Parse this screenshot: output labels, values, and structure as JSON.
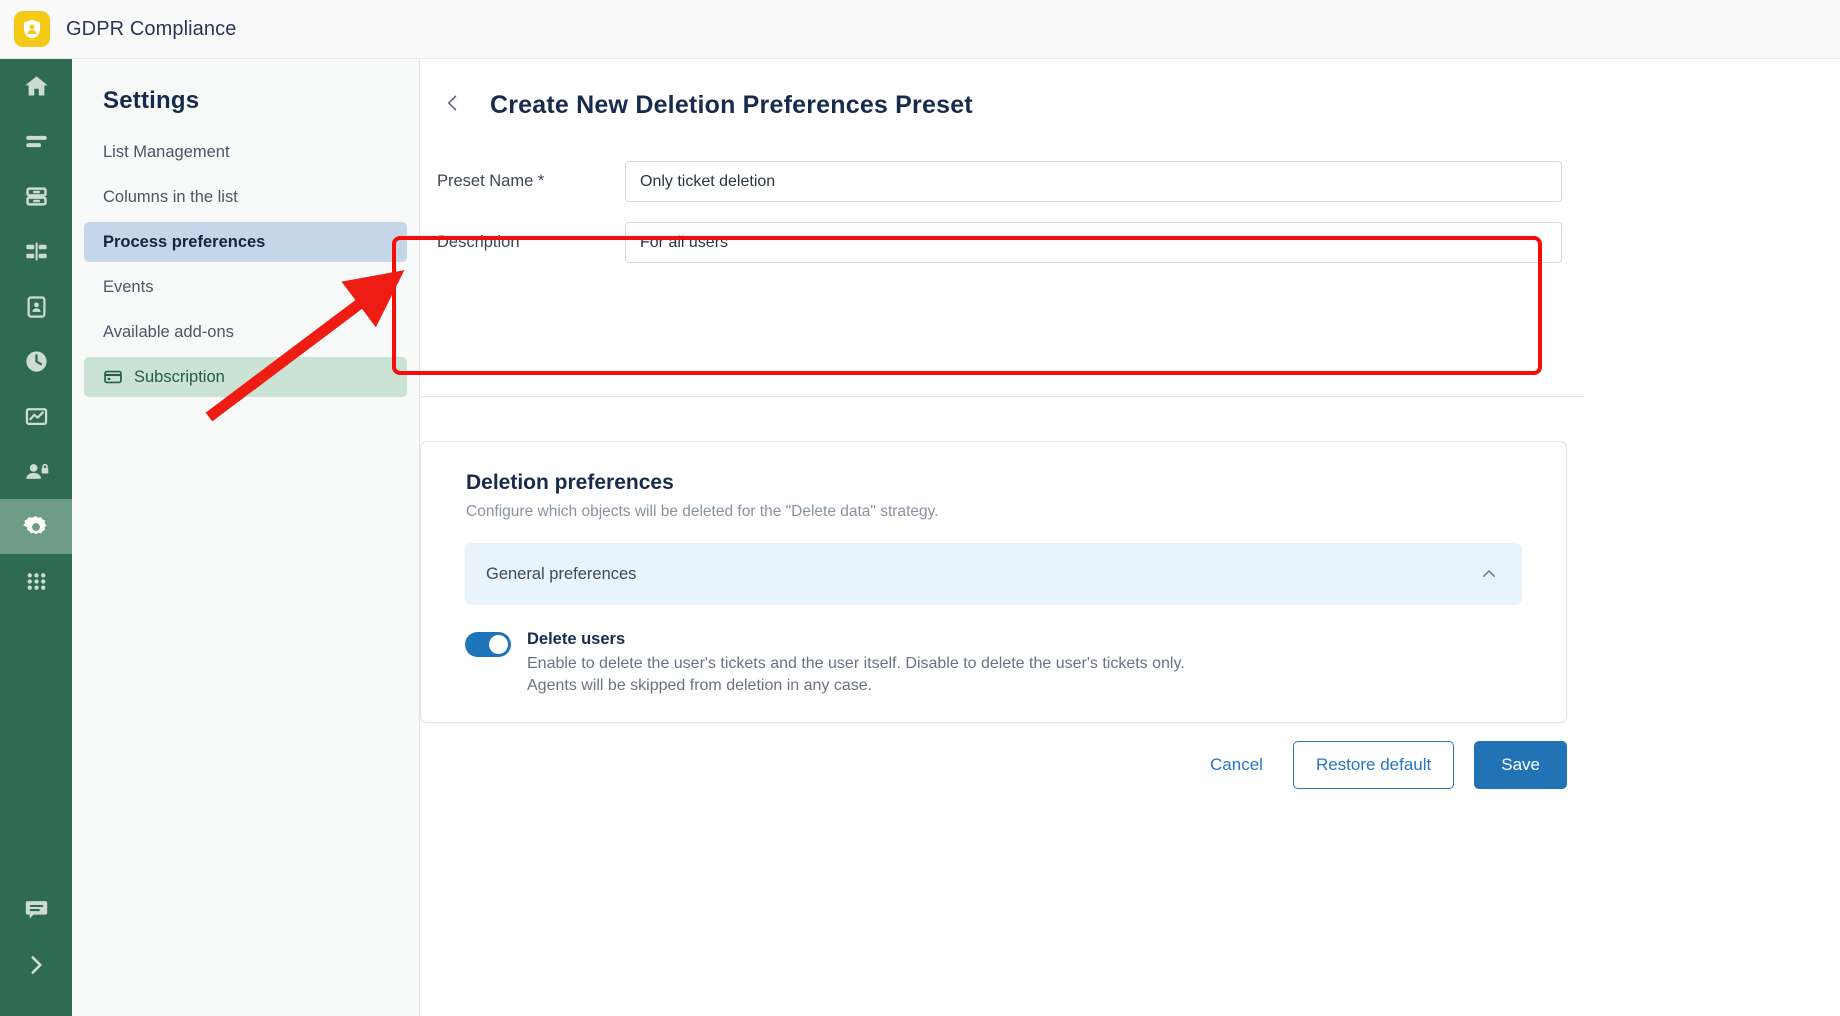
{
  "header": {
    "app_title": "GDPR Compliance",
    "logo_icon": "shield-person-icon"
  },
  "rail": {
    "items": [
      {
        "icon": "home-icon",
        "active": false
      },
      {
        "icon": "list-lines-icon",
        "active": false
      },
      {
        "icon": "database-icon",
        "active": false
      },
      {
        "icon": "filter-bars-icon",
        "active": false
      },
      {
        "icon": "clipboard-person-icon",
        "active": false
      },
      {
        "icon": "clock-icon",
        "active": false
      },
      {
        "icon": "chart-icon",
        "active": false
      },
      {
        "icon": "user-lock-icon",
        "active": false
      },
      {
        "icon": "gear-icon",
        "active": true
      },
      {
        "icon": "apps-grid-icon",
        "active": false
      }
    ],
    "bottom_items": [
      {
        "icon": "chat-bubble-icon"
      },
      {
        "icon": "chevron-right-icon"
      }
    ]
  },
  "sidebar": {
    "title": "Settings",
    "items": [
      {
        "label": "List Management",
        "state": "normal"
      },
      {
        "label": "Columns in the list",
        "state": "normal"
      },
      {
        "label": "Process preferences",
        "state": "selected"
      },
      {
        "label": "Events",
        "state": "normal"
      },
      {
        "label": "Available add-ons",
        "state": "normal"
      },
      {
        "label": "Subscription",
        "state": "highlighted",
        "icon": "credit-card-icon"
      }
    ]
  },
  "main": {
    "back_icon": "chevron-left-icon",
    "page_title": "Create New Deletion Preferences Preset",
    "form": {
      "preset_name": {
        "label": "Preset Name *",
        "value": "Only ticket deletion"
      },
      "description": {
        "label": "Description",
        "value": "For all users"
      }
    },
    "card": {
      "title": "Deletion preferences",
      "subtitle": "Configure which objects will be deleted for the \"Delete data\" strategy.",
      "accordion": {
        "label": "General preferences",
        "expanded": true,
        "chevron_icon": "chevron-up-icon"
      },
      "toggle": {
        "label": "Delete users",
        "enabled": true,
        "description_line1": "Enable to delete the user's tickets and the user itself. Disable to delete the user's tickets only.",
        "description_line2": "Agents will be skipped from deletion in any case."
      }
    },
    "buttons": {
      "cancel": "Cancel",
      "restore_default": "Restore default",
      "save": "Save"
    }
  },
  "annotations": {
    "rect_color": "#f70d08",
    "arrow_color": "#ee1c12"
  },
  "colors": {
    "rail_bg": "#2f6b4f",
    "rail_active": "#6f9c85",
    "logo_bg": "#f6c917",
    "selected_nav": "#c5d6e8",
    "highlight_nav": "#cbe3d4",
    "accordion_bg": "#e9f3fb",
    "toggle_on": "#1d74b8",
    "primary_button": "#2273b5"
  }
}
